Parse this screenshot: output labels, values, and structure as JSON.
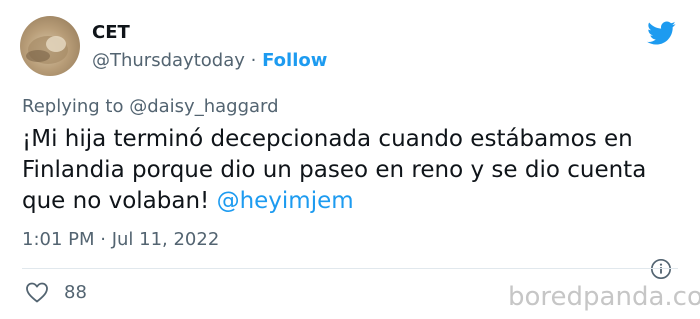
{
  "tweet": {
    "author_name": "CET",
    "handle": "@Thursdaytoday",
    "separator": "·",
    "follow_label": "Follow",
    "replying_prefix": "Replying to",
    "replying_to": "@daisy_haggard",
    "text_line1": "¡Mi hija terminó decepcionada cuando estábamos en",
    "text_line2": "Finlandia porque dio un paseo en reno y se dio cuenta",
    "text_line3": "que no volaban!",
    "text_mention": "@heyimjem",
    "timestamp": "1:01 PM · Jul 11, 2022",
    "likes": "88"
  },
  "icons": {
    "logo": "twitter-bird-icon",
    "info": "info-icon",
    "like": "heart-icon"
  },
  "watermark": "boredpanda.com",
  "colors": {
    "accent": "#1d9bf0",
    "text": "#0f1419",
    "muted": "#536471",
    "watermark": "#c6c6c6"
  }
}
